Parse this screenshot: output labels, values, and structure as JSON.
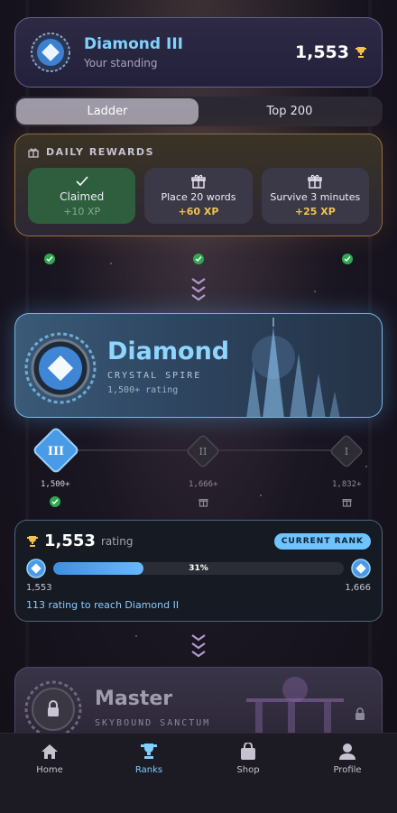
{
  "standing": {
    "title": "Diamond III",
    "subtitle": "Your standing",
    "score": "1,553"
  },
  "tabs": [
    {
      "label": "Ladder",
      "active": true
    },
    {
      "label": "Top 200",
      "active": false
    }
  ],
  "daily": {
    "heading": "DAILY REWARDS",
    "items": [
      {
        "label": "Claimed",
        "reward": "+10 XP",
        "claimed": true
      },
      {
        "label": "Place 20 words",
        "reward": "+60 XP",
        "claimed": false
      },
      {
        "label": "Survive 3 minutes",
        "reward": "+25 XP",
        "claimed": false
      }
    ]
  },
  "tier": {
    "name": "Diamond",
    "subtitle": "CRYSTAL SPIRE",
    "rating": "1,500+ rating"
  },
  "divisions": [
    {
      "numeral": "III",
      "threshold": "1,500+",
      "current": true
    },
    {
      "numeral": "II",
      "threshold": "1,666+",
      "current": false
    },
    {
      "numeral": "I",
      "threshold": "1,832+",
      "current": false
    }
  ],
  "progress": {
    "rating": "1,553",
    "rating_label": "rating",
    "badge": "CURRENT RANK",
    "percent_label": "31%",
    "percent": 31,
    "min": "1,553",
    "max": "1,666",
    "reach": "113 rating to reach Diamond II"
  },
  "master": {
    "name": "Master",
    "subtitle": "SKYBOUND SANCTUM"
  },
  "nav": [
    {
      "label": "Home",
      "icon": "home-icon",
      "active": false
    },
    {
      "label": "Ranks",
      "icon": "trophy-icon",
      "active": true
    },
    {
      "label": "Shop",
      "icon": "bag-icon",
      "active": false
    },
    {
      "label": "Profile",
      "icon": "person-icon",
      "active": false
    }
  ],
  "colors": {
    "accent": "#7fd0ff",
    "gold": "#f2c14e",
    "claimed": "#2e5e3e",
    "check": "#2fa84f"
  }
}
